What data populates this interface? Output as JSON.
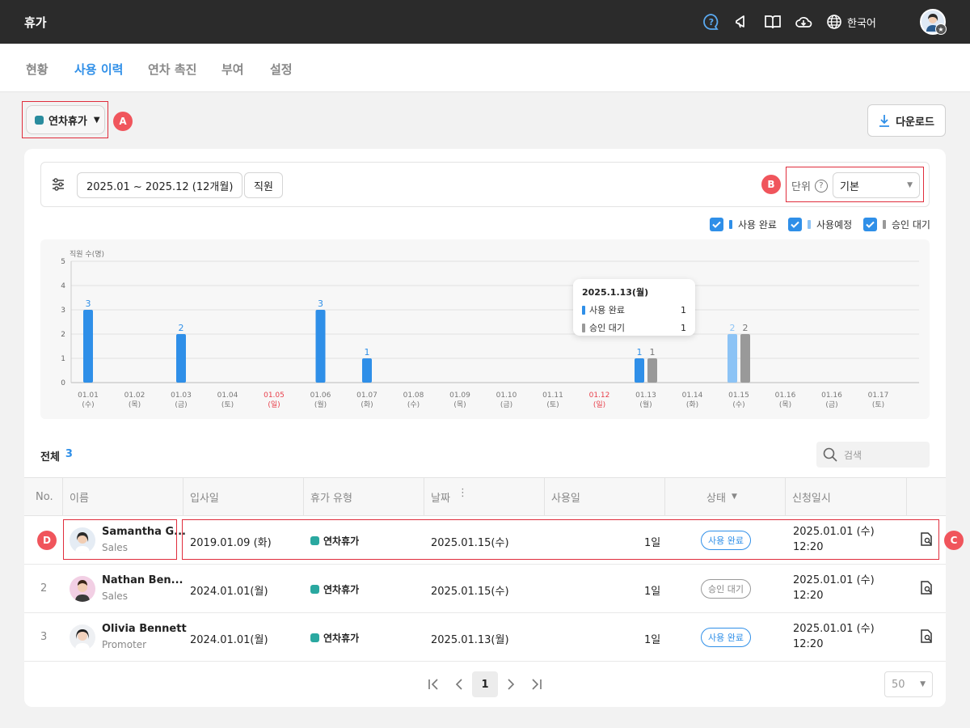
{
  "app": {
    "title": "휴가",
    "language": "한국어"
  },
  "tabs": [
    {
      "label": "현황",
      "active": false
    },
    {
      "label": "사용 이력",
      "active": true
    },
    {
      "label": "연차 촉진",
      "active": false
    },
    {
      "label": "부여",
      "active": false
    },
    {
      "label": "설정",
      "active": false
    }
  ],
  "leave_type_select": {
    "value": "연차휴가",
    "color": "#2a8c9e"
  },
  "annotations": {
    "a": "A",
    "b": "B",
    "c": "C",
    "d": "D"
  },
  "download_label": "다운로드",
  "filters": {
    "date_range": "2025.01 ~ 2025.12 (12개월)",
    "group": "직원",
    "unit_label": "단위",
    "unit_value": "기본"
  },
  "legend": [
    {
      "label": "사용 완료",
      "color": "#2f8fe8",
      "checked": true
    },
    {
      "label": "사용예정",
      "color": "#8cc3f5",
      "checked": true
    },
    {
      "label": "승인 대기",
      "color": "#999999",
      "checked": true
    }
  ],
  "chart_data": {
    "type": "bar",
    "ylabel": "직원 수(명)",
    "ylim": [
      0,
      5
    ],
    "yticks": [
      "0",
      "1",
      "2",
      "3",
      "4",
      "5"
    ],
    "categories": [
      "01.01",
      "01.02",
      "01.03",
      "01.04",
      "01.05",
      "01.06",
      "01.07",
      "01.08",
      "01.09",
      "01.10",
      "01.11",
      "01.12",
      "01.13",
      "01.14",
      "01.15",
      "01.16",
      "01.16",
      "01.17"
    ],
    "days": [
      "(수)",
      "(목)",
      "(금)",
      "(토)",
      "(일)",
      "(월)",
      "(화)",
      "(수)",
      "(목)",
      "(금)",
      "(토)",
      "(일)",
      "(월)",
      "(화)",
      "(수)",
      "(목)",
      "(금)",
      "(토)"
    ],
    "holiday_indices": [
      4,
      11
    ],
    "holiday_color": "#e8414c",
    "series": [
      {
        "name": "사용 완료",
        "color": "#2f8fe8",
        "values": [
          3,
          0,
          2,
          0,
          0,
          3,
          1,
          0,
          0,
          0,
          0,
          0,
          1,
          0,
          0,
          0,
          0,
          0
        ]
      },
      {
        "name": "사용예정",
        "color": "#8cc3f5",
        "values": [
          0,
          0,
          0,
          0,
          0,
          0,
          0,
          0,
          0,
          0,
          0,
          0,
          0,
          0,
          2,
          0,
          0,
          0
        ]
      },
      {
        "name": "승인 대기",
        "color": "#999999",
        "values": [
          0,
          0,
          0,
          0,
          0,
          0,
          0,
          0,
          0,
          0,
          0,
          0,
          1,
          0,
          2,
          0,
          0,
          0
        ]
      }
    ],
    "tooltip": {
      "title": "2025.1.13(월)",
      "rows": [
        {
          "label": "사용 완료",
          "value": "1",
          "color": "#2f8fe8"
        },
        {
          "label": "승인 대기",
          "value": "1",
          "color": "#999999"
        }
      ]
    }
  },
  "list": {
    "total_label": "전체",
    "total_count": "3",
    "search_placeholder": "검색",
    "columns": [
      "No.",
      "이름",
      "입사일",
      "휴가 유형",
      "날짜",
      "사용일",
      "상태",
      "신청일시"
    ],
    "rows": [
      {
        "no": "",
        "name": "Samantha G...",
        "dept": "Sales",
        "hire_date": "2019.01.09 (화)",
        "leave_type": "연차휴가",
        "date": "2025.01.15(수)",
        "days": "1일",
        "status": "사용 완료",
        "req_date": "2025.01.01 (수)",
        "req_time": "12:20"
      },
      {
        "no": "2",
        "name": "Nathan Ben...",
        "dept": "Sales",
        "hire_date": "2024.01.01(월)",
        "leave_type": "연차휴가",
        "date": "2025.01.15(수)",
        "days": "1일",
        "status": "승인 대기",
        "req_date": "2025.01.01 (수)",
        "req_time": "12:20"
      },
      {
        "no": "3",
        "name": "Olivia Bennett",
        "dept": "Promoter",
        "hire_date": "2024.01.01(월)",
        "leave_type": "연차휴가",
        "date": "2025.01.13(월)",
        "days": "1일",
        "status": "사용 완료",
        "req_date": "2025.01.01 (수)",
        "req_time": "12:20"
      }
    ]
  },
  "pagination": {
    "current": "1",
    "per_page": "50"
  }
}
